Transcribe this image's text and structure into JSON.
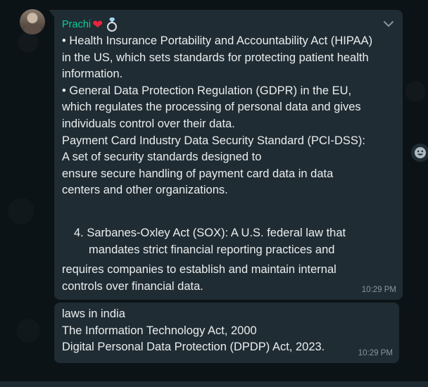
{
  "messages": [
    {
      "sender": "Prachi",
      "sender_emojis": [
        "red-heart",
        "ring"
      ],
      "lines": [
        "• Health Insurance Portability and Accountability Act (HIPAA)",
        "in the US, which sets standards for protecting patient health",
        "information.",
        "• General Data Protection Regulation (GDPR) in the EU,",
        "which regulates the processing of personal data and gives",
        "individuals control over their data.",
        "Payment Card Industry Data Security Standard (PCI-DSS):",
        "A set of security standards designed to",
        "ensure secure handling of payment card data in data",
        "centers and other organizations."
      ],
      "numbered_item": {
        "number": "4.",
        "line1": "Sarbanes-Oxley Act (SOX): A U.S. federal law that",
        "line2": "mandates strict financial reporting practices and"
      },
      "tail_lines": [
        "requires companies to establish and maintain internal",
        "controls over financial data."
      ],
      "time": "10:29 PM"
    },
    {
      "lines": [
        "laws in india",
        "The Information Technology Act, 2000",
        "Digital Personal Data Protection (DPDP) Act, 2023."
      ],
      "time": "10:29 PM"
    }
  ],
  "icons": {
    "menu": "chevron-down-icon",
    "react": "emoji-icon"
  },
  "colors": {
    "background": "#0b141a",
    "bubble": "#202c33",
    "sender": "#06cf9c",
    "text": "#e9edef",
    "meta": "#8696a0"
  }
}
